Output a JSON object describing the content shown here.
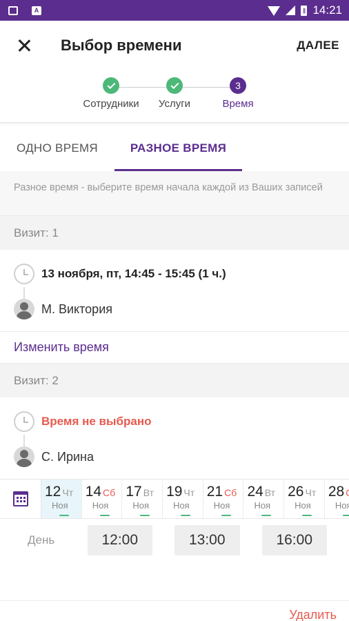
{
  "status_bar": {
    "time": "14:21",
    "battery_glyph": "∥",
    "icons": [
      "image-icon",
      "a-icon",
      "wifi-icon",
      "signal-icon",
      "battery-icon"
    ]
  },
  "toolbar": {
    "title": "Выбор времени",
    "next_label": "ДАЛЕЕ"
  },
  "stepper": {
    "steps": [
      {
        "label": "Сотрудники",
        "state": "done"
      },
      {
        "label": "Услуги",
        "state": "done"
      },
      {
        "label": "Время",
        "state": "current",
        "number": "3"
      }
    ]
  },
  "tabs": [
    {
      "label": "ОДНО ВРЕМЯ",
      "active": false
    },
    {
      "label": "РАЗНОЕ ВРЕМЯ",
      "active": true
    }
  ],
  "hint": "Разное время - выберите время начала каждой из Ваших записей",
  "visits": [
    {
      "header": "Визит: 1",
      "time": "13 ноября, пт, 14:45 - 15:45 (1 ч.)",
      "staff": "М. Виктория",
      "change_label": "Изменить время"
    },
    {
      "header": "Визит: 2",
      "time": "Время не выбрано",
      "staff": "С. Ирина"
    }
  ],
  "dates": [
    {
      "day": "12",
      "weekday": "Чт",
      "month": "Ноя",
      "selected": true,
      "weekend": false
    },
    {
      "day": "14",
      "weekday": "Сб",
      "month": "Ноя",
      "selected": false,
      "weekend": true
    },
    {
      "day": "17",
      "weekday": "Вт",
      "month": "Ноя",
      "selected": false,
      "weekend": false
    },
    {
      "day": "19",
      "weekday": "Чт",
      "month": "Ноя",
      "selected": false,
      "weekend": false
    },
    {
      "day": "21",
      "weekday": "Сб",
      "month": "Ноя",
      "selected": false,
      "weekend": true
    },
    {
      "day": "24",
      "weekday": "Вт",
      "month": "Ноя",
      "selected": false,
      "weekend": false
    },
    {
      "day": "26",
      "weekday": "Чт",
      "month": "Ноя",
      "selected": false,
      "weekend": false
    },
    {
      "day": "28",
      "weekday": "Сб",
      "month": "Ноя",
      "selected": false,
      "weekend": true
    }
  ],
  "slots": {
    "day_label": "День",
    "times": [
      "12:00",
      "13:00",
      "16:00"
    ]
  },
  "delete_label": "Удалить",
  "colors": {
    "brand": "#5b2d8e",
    "success": "#4cb87a",
    "danger": "#e85a4f",
    "selected_bg": "#e8f5fa"
  }
}
